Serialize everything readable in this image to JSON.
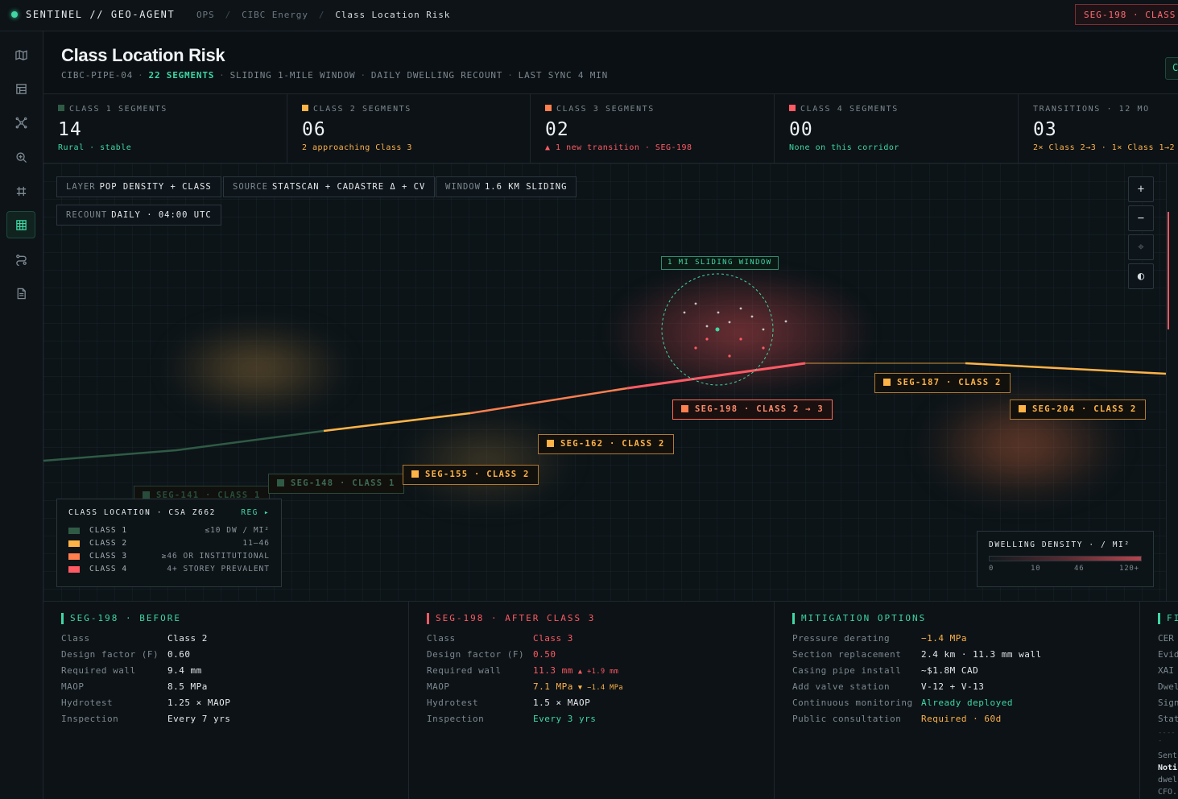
{
  "topbar": {
    "brand": "SENTINEL // GEO-AGENT",
    "crumbs": [
      "OPS",
      "CIBC Energy",
      "Class Location Risk"
    ],
    "alert": "SEG-198 · CLASS"
  },
  "sidebar": {
    "items": [
      {
        "icon": "map-icon",
        "active": false
      },
      {
        "icon": "layout-icon",
        "active": false
      },
      {
        "icon": "network-icon",
        "active": false
      },
      {
        "icon": "zoom-search-icon",
        "active": false
      },
      {
        "icon": "hash-grid-icon",
        "active": false
      },
      {
        "icon": "grid-table-icon",
        "active": true
      },
      {
        "icon": "route-icon",
        "active": false
      },
      {
        "icon": "document-icon",
        "active": false
      }
    ]
  },
  "header": {
    "title": "Class Location Risk",
    "pipe": "CIBC-PIPE-04",
    "segments": "22 SEGMENTS",
    "window": "SLIDING 1-MILE WINDOW",
    "recount": "DAILY DWELLING RECOUNT",
    "sync": "LAST SYNC 4 MIN",
    "action_icon": "C"
  },
  "stats": [
    {
      "label": "CLASS 1 SEGMENTS",
      "value": "14",
      "note": "Rural · stable",
      "color": "#2f5b45",
      "note_color": "#3fd7a4"
    },
    {
      "label": "CLASS 2 SEGMENTS",
      "value": "06",
      "note": "2 approaching Class 3",
      "color": "#ffb347",
      "note_color": "#ffb347"
    },
    {
      "label": "CLASS 3 SEGMENTS",
      "value": "02",
      "note": "▲ 1 new transition · SEG-198",
      "color": "#ff7f4f",
      "note_color": "#ff5a64"
    },
    {
      "label": "CLASS 4 SEGMENTS",
      "value": "00",
      "note": "None on this corridor",
      "color": "#ff5a64",
      "note_color": "#3fd7a4"
    },
    {
      "label": "TRANSITIONS · 12 MO",
      "value": "03",
      "note": "2× Class 2→3 · 1× Class 1→2",
      "color": "",
      "note_color": "#ffb347"
    }
  ],
  "map": {
    "chips": [
      {
        "k": "LAYER",
        "v": "POP DENSITY + CLASS"
      },
      {
        "k": "SOURCE",
        "v": "STATSCAN + CADASTRE Δ + CV"
      },
      {
        "k": "WINDOW",
        "v": "1.6 KM SLIDING"
      },
      {
        "k": "RECOUNT",
        "v": "DAILY · 04:00 UTC"
      }
    ],
    "controls": [
      "+",
      "−",
      "⌖",
      "◐"
    ],
    "window_tag": "1 MI SLIDING WINDOW",
    "segments": [
      {
        "id": "seg-141",
        "text": "SEG-141 · CLASS 1",
        "class": 1
      },
      {
        "id": "seg-148",
        "text": "SEG-148 · CLASS 1",
        "class": 1
      },
      {
        "id": "seg-155",
        "text": "SEG-155 · CLASS 2",
        "class": 2
      },
      {
        "id": "seg-162",
        "text": "SEG-162 · CLASS 2",
        "class": 2
      },
      {
        "id": "seg-198",
        "text": "SEG-198 · CLASS 2 → 3",
        "class": 3
      },
      {
        "id": "seg-187",
        "text": "SEG-187 · CLASS 2",
        "class": 2
      },
      {
        "id": "seg-204",
        "text": "SEG-204 · CLASS 2",
        "class": 2
      }
    ],
    "legend": {
      "title": "CLASS LOCATION · CSA Z662",
      "reg": "REG ▸",
      "rows": [
        {
          "name": "CLASS 1",
          "range": "≤10 DW / MI²",
          "color": "#2f5b45"
        },
        {
          "name": "CLASS 2",
          "range": "11–46",
          "color": "#ffb347"
        },
        {
          "name": "CLASS 3",
          "range": "≥46 OR INSTITUTIONAL",
          "color": "#ff7f4f"
        },
        {
          "name": "CLASS 4",
          "range": "4+ STOREY PREVALENT",
          "color": "#ff5a64"
        }
      ]
    },
    "density": {
      "title": "DWELLING DENSITY · / MI²",
      "ticks": [
        "0",
        "10",
        "46",
        "120+"
      ]
    }
  },
  "panels": {
    "before": {
      "title": "SEG-198 · BEFORE",
      "rows": [
        {
          "k": "Class",
          "v": "Class 2"
        },
        {
          "k": "Design factor (F)",
          "v": "0.60"
        },
        {
          "k": "Required wall",
          "v": "9.4 mm"
        },
        {
          "k": "MAOP",
          "v": "8.5 MPa"
        },
        {
          "k": "Hydrotest",
          "v": "1.25 × MAOP"
        },
        {
          "k": "Inspection",
          "v": "Every 7 yrs"
        }
      ]
    },
    "after": {
      "title": "SEG-198 · AFTER CLASS 3",
      "rows": [
        {
          "k": "Class",
          "v": "Class 3",
          "color": "#ff5a64",
          "delta": ""
        },
        {
          "k": "Design factor (F)",
          "v": "0.50",
          "color": "#ff5a64",
          "delta": ""
        },
        {
          "k": "Required wall",
          "v": "11.3 mm",
          "color": "#ff5a64",
          "delta": "▲ +1.9 mm",
          "delta_color": "#ff5a64"
        },
        {
          "k": "MAOP",
          "v": "7.1 MPa",
          "color": "#ffb347",
          "delta": "▼ −1.4 MPa",
          "delta_color": "#ffb347"
        },
        {
          "k": "Hydrotest",
          "v": "1.5 × MAOP",
          "color": "#e4e9ec",
          "delta": ""
        },
        {
          "k": "Inspection",
          "v": "Every 3 yrs",
          "color": "#3fd7a4",
          "delta": ""
        }
      ]
    },
    "mitigation": {
      "title": "MITIGATION OPTIONS",
      "rows": [
        {
          "k": "Pressure derating",
          "v": "−1.4 MPa",
          "color": "#ffb347"
        },
        {
          "k": "Section replacement",
          "v": "2.4 km · 11.3 mm wall",
          "color": "#e4e9ec"
        },
        {
          "k": "Casing pipe install",
          "v": "~$1.8M CAD",
          "color": "#e4e9ec"
        },
        {
          "k": "Add valve station",
          "v": "V-12 + V-13",
          "color": "#e4e9ec"
        },
        {
          "k": "Continuous monitoring",
          "v": "Already deployed",
          "color": "#3fd7a4"
        },
        {
          "k": "Public consultation",
          "v": "Required · 60d",
          "color": "#ffb347"
        }
      ]
    },
    "fourth": {
      "title": "FI",
      "rows": [
        "CER",
        "Evid",
        "XAI",
        "Dwel",
        "Sign",
        "Stat"
      ],
      "dash": "-----",
      "footer": [
        "Sent",
        "Noti",
        "dwel",
        "CFO."
      ]
    }
  }
}
